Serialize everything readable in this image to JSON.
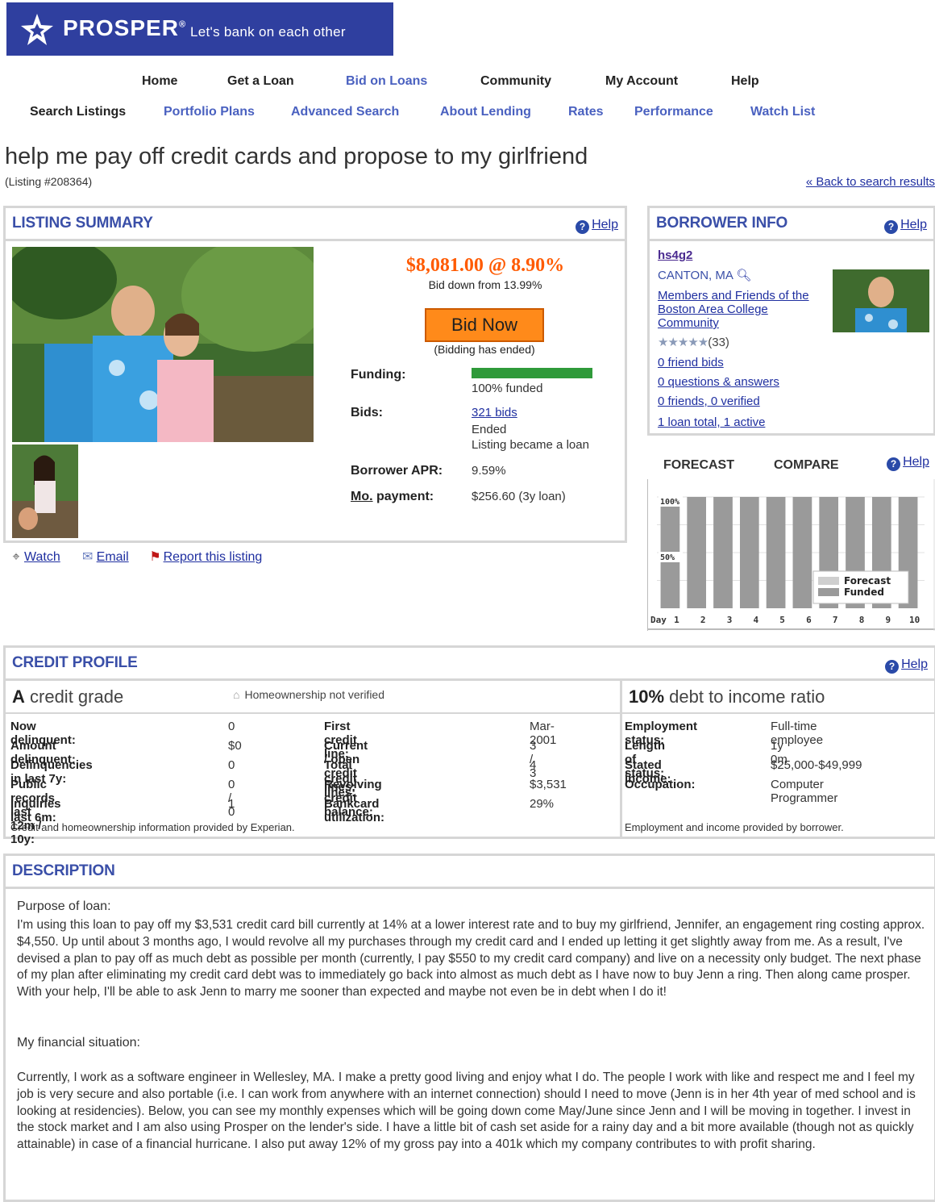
{
  "brand": {
    "name": "PROSPER",
    "tagline": "Let's bank on each other",
    "colors": {
      "header_bg": "#2f3f9f",
      "accent": "#ff5a00",
      "link": "#1f2fa0",
      "panel_title": "#3a4fa8"
    }
  },
  "nav_primary": [
    "Home",
    "Get a Loan",
    "Bid on Loans",
    "Community",
    "My Account",
    "Help"
  ],
  "nav_secondary": [
    "Search Listings",
    "Portfolio Plans",
    "Advanced Search",
    "About Lending",
    "Rates",
    "Performance",
    "Watch List"
  ],
  "listing": {
    "title": "help me pay off credit cards and propose to my girlfriend",
    "number": "(Listing #208364)",
    "back_link": "« Back to search results"
  },
  "summary": {
    "heading": "LISTING SUMMARY",
    "help": "Help",
    "price": "$8,081.00 @ 8.90%",
    "bid_down": "Bid down from 13.99%",
    "bid_button": "Bid Now",
    "bid_status": "(Bidding has ended)",
    "funding_label": "Funding:",
    "funding_percent": 100,
    "funding_text": "100% funded",
    "bids_label": "Bids:",
    "bids_link": "321 bids",
    "bids_status1": "Ended",
    "bids_status2": "Listing became a loan",
    "apr_label": "Borrower APR:",
    "apr_value": "9.59%",
    "payment_label_a": "Mo.",
    "payment_label_b": " payment:",
    "payment_value": "$256.60 (3y loan)"
  },
  "actions": {
    "watch": "Watch",
    "email": "Email",
    "report": "Report this listing"
  },
  "borrower": {
    "heading": "BORROWER INFO",
    "help": "Help",
    "username": "hs4g2",
    "location": "CANTON, MA",
    "group_line1": "Members and Friends of the",
    "group_line2": "Boston Area College",
    "group_line3": "Community",
    "rating_stars": 5,
    "rating_count": "(33)",
    "friend_bids": "0 friend bids",
    "questions": "0 questions & answers",
    "friends": "0 friends, 0 verified",
    "loans": "1 loan total, 1 active"
  },
  "forecast": {
    "tab_forecast": "FORECAST",
    "tab_compare": "COMPARE",
    "help": "Help"
  },
  "chart_data": {
    "type": "bar",
    "categories": [
      "1",
      "2",
      "3",
      "4",
      "5",
      "6",
      "7",
      "8",
      "9",
      "10"
    ],
    "x_prefix": "Day",
    "series": [
      {
        "name": "Forecast",
        "color": "#cfcfcf",
        "values": [
          100,
          100,
          100,
          100,
          100,
          100,
          100,
          100,
          100,
          100
        ]
      },
      {
        "name": "Funded",
        "color": "#9a9a9a",
        "values": [
          100,
          100,
          100,
          100,
          100,
          100,
          100,
          100,
          100,
          100
        ]
      }
    ],
    "ytick_labels": [
      "100%",
      "50%"
    ],
    "ylim": [
      0,
      100
    ],
    "legend": "bottom-right"
  },
  "credit": {
    "heading": "CREDIT PROFILE",
    "help": "Help",
    "grade_letter": "A",
    "grade_text": " credit grade",
    "homeownership": "Homeownership not verified",
    "dti_value": "10%",
    "dti_text": " debt to income ratio",
    "left_rows": [
      {
        "label": "Now delinquent:",
        "value": "0"
      },
      {
        "label": "Amount delinquent:",
        "value": "$0"
      },
      {
        "label": "Delinquencies in last 7y:",
        "value": "0"
      },
      {
        "label": "Public records last 12m / 10y:",
        "value": "0 / 0"
      },
      {
        "label": "Inquiries last 6m:",
        "value": "1"
      }
    ],
    "mid_rows": [
      {
        "label": "First credit line:",
        "value": "Mar-2001"
      },
      {
        "label": "Current / open credit lines:",
        "value": "3 / 3"
      },
      {
        "label": "Total credit lines:",
        "value": "4"
      },
      {
        "label": "Revolving credit balance:",
        "value": "$3,531"
      },
      {
        "label": "Bankcard utilization:",
        "value": "29%"
      }
    ],
    "right_rows": [
      {
        "label": "Employment status:",
        "value": "Full-time employee"
      },
      {
        "label": "Length of status:",
        "value": "1y 0m"
      },
      {
        "label": "Stated income:",
        "value": "$25,000-$49,999"
      },
      {
        "label": "Occupation:",
        "value": "Computer Programmer"
      }
    ],
    "note_left": "Credit and homeownership information provided by Experian.",
    "note_right": "Employment and income provided by borrower."
  },
  "description": {
    "heading": "DESCRIPTION",
    "purpose_heading": "Purpose of loan:",
    "purpose_text": "I'm using this loan to pay off my $3,531 credit card bill currently at 14% at a lower interest rate and to buy my girlfriend, Jennifer, an engagement ring costing approx. $4,550.  Up until about 3 months ago, I would revolve all my purchases through my credit card and I ended up letting it get slightly away from me.  As a result, I've devised a plan to pay off as much debt as possible per month (currently, I pay $550 to my credit card company) and live on a necessity only budget.  The next phase of my plan after eliminating my credit card debt was to immediately go back into almost as much debt as I have now to buy Jenn a ring.  Then along came prosper.  With your help, I'll be able to ask Jenn to marry me sooner than expected and maybe not even be in debt when I do it!",
    "situation_heading": "My financial situation:",
    "situation_text": "Currently, I work as a software engineer in Wellesley, MA.  I make a pretty good living and enjoy what I do.  The people I work with like and respect me and I feel my job is very secure and also portable (i.e. I can work from anywhere with an internet connection) should I need to move (Jenn is in her 4th year of med school and is looking at residencies).  Below, you can see my monthly expenses which will be going down come May/June since Jenn and I will be moving in together.  I invest in the stock market and I am also using Prosper on the lender's side.  I have a little bit of cash set aside for a rainy day and a bit more available (though not as quickly attainable) in case of a financial hurricane.  I also put away 12% of my gross pay into a 401k which my company contributes to with profit sharing."
  }
}
